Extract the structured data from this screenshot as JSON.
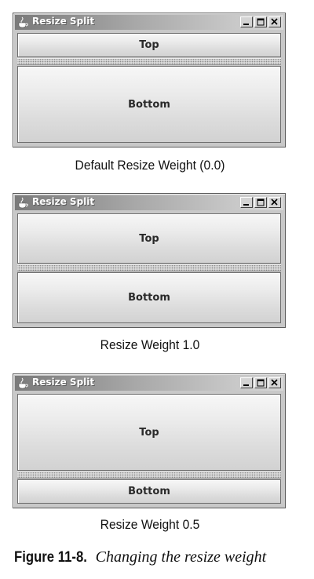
{
  "windows": [
    {
      "title": "Resize Split",
      "top_label": "Top",
      "bottom_label": "Bottom",
      "caption": "Default Resize Weight (0.0)"
    },
    {
      "title": "Resize Split",
      "top_label": "Top",
      "bottom_label": "Bottom",
      "caption": "Resize Weight 1.0"
    },
    {
      "title": "Resize Split",
      "top_label": "Top",
      "bottom_label": "Bottom",
      "caption": "Resize Weight 0.5"
    }
  ],
  "figure": {
    "label": "Figure 11-8.",
    "title": "Changing the resize weight"
  },
  "icons": {
    "app": "java-cup-icon",
    "minimize": "minimize-icon",
    "maximize": "maximize-icon",
    "close": "close-icon"
  }
}
